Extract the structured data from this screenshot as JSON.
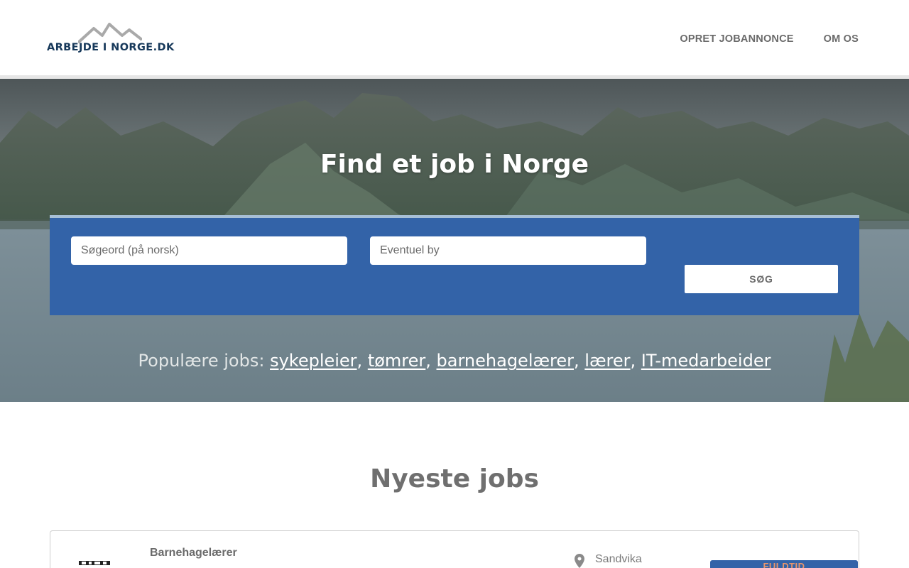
{
  "header": {
    "logo_text": "ARBEJDE I NORGE.DK",
    "nav": [
      "OPRET JOBANNONCE",
      "OM OS"
    ]
  },
  "hero": {
    "title": "Find et job i Norge",
    "search": {
      "keyword_placeholder": "Søgeord (på norsk)",
      "city_placeholder": "Eventuel by",
      "button_label": "SØG"
    },
    "popular_label": "Populære jobs:",
    "popular_jobs": [
      "sykepleier",
      "tømrer",
      "barnehagelærer",
      "lærer",
      "IT-medarbeider"
    ]
  },
  "newest": {
    "title": "Nyeste jobs",
    "jobs": [
      {
        "title": "Barnehagelærer",
        "city": "Sandvika",
        "type": "FULDTID",
        "icon": "map-pin-icon"
      }
    ]
  },
  "colors": {
    "brand_navy": "#16385a",
    "panel_blue": "#3363a8",
    "badge_text": "#e8946c"
  }
}
